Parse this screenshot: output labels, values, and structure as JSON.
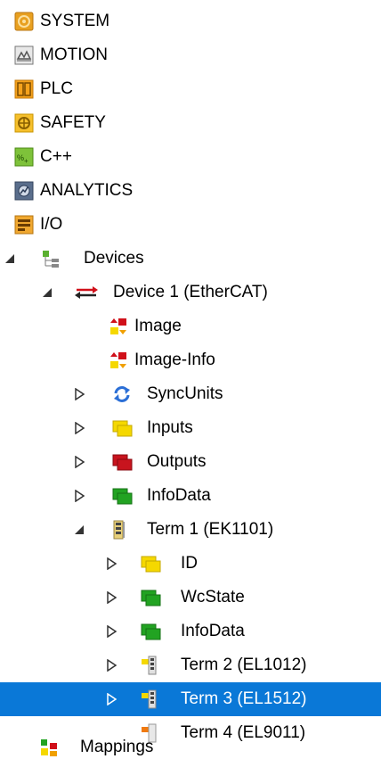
{
  "tree": {
    "system": "SYSTEM",
    "motion": "MOTION",
    "plc": "PLC",
    "safety": "SAFETY",
    "cpp": "C++",
    "analytics": "ANALYTICS",
    "io": "I/O",
    "devices": "Devices",
    "device1": "Device 1 (EtherCAT)",
    "image": "Image",
    "image_info": "Image-Info",
    "syncunits": "SyncUnits",
    "inputs": "Inputs",
    "outputs": "Outputs",
    "infodata": "InfoData",
    "term1": "Term 1 (EK1101)",
    "id": "ID",
    "wcstate": "WcState",
    "term1_infodata": "InfoData",
    "term2": "Term 2 (EL1012)",
    "term3": "Term 3 (EL1512)",
    "term4": "Term 4 (EL9011)",
    "mappings": "Mappings"
  },
  "colors": {
    "selection": "#0a78d7",
    "input_yellow": "#f5d800",
    "output_red": "#c8141e",
    "info_green": "#22a322",
    "sync_blue": "#2b6fd6"
  },
  "icons": [
    "system-icon",
    "motion-icon",
    "plc-icon",
    "safety-icon",
    "cpp-icon",
    "analytics-icon",
    "io-icon",
    "devices-icon",
    "ethercat-device-icon",
    "image-icon",
    "image-info-icon",
    "syncunits-icon",
    "inputs-icon",
    "outputs-icon",
    "infodata-icon",
    "terminal-icon",
    "id-icon",
    "wcstate-icon",
    "mappings-icon"
  ]
}
